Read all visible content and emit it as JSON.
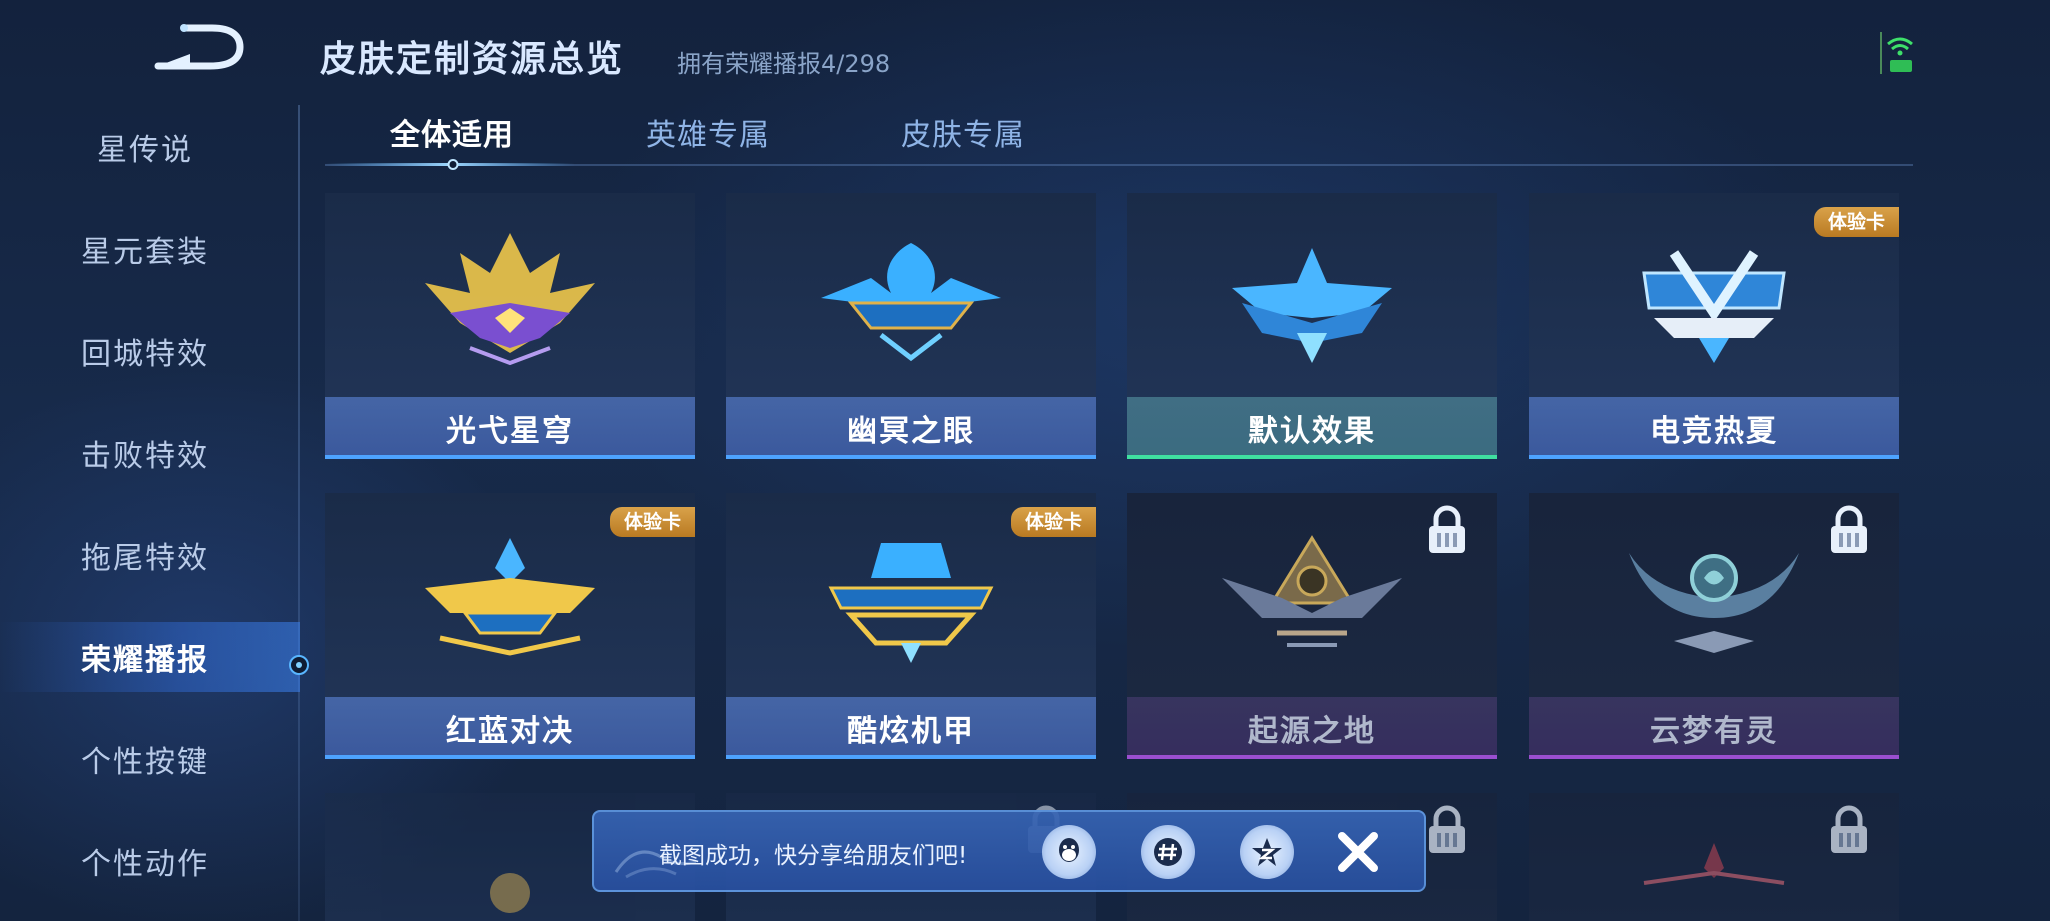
{
  "header": {
    "title": "皮肤定制资源总览",
    "subtitle": "拥有荣耀播报4/298"
  },
  "sidebar": {
    "items": [
      {
        "label": "星传说"
      },
      {
        "label": "星元套装"
      },
      {
        "label": "回城特效"
      },
      {
        "label": "击败特效"
      },
      {
        "label": "拖尾特效"
      },
      {
        "label": "荣耀播报",
        "active": true
      },
      {
        "label": "个性按键"
      },
      {
        "label": "个性动作"
      }
    ]
  },
  "tabs": [
    {
      "label": "全体适用",
      "active": true
    },
    {
      "label": "英雄专属"
    },
    {
      "label": "皮肤专属"
    }
  ],
  "cards": [
    {
      "label": "光弋星穹"
    },
    {
      "label": "幽冥之眼"
    },
    {
      "label": "默认效果"
    },
    {
      "label": "电竞热夏",
      "badge": "体验卡"
    },
    {
      "label": "红蓝对决",
      "badge": "体验卡"
    },
    {
      "label": "酷炫机甲",
      "badge": "体验卡"
    },
    {
      "label": "起源之地",
      "locked": true
    },
    {
      "label": "云梦有灵",
      "locked": true
    }
  ],
  "toast": {
    "message": "截图成功，快分享给朋友们吧!"
  },
  "colors": {
    "accent": "#4da3ff",
    "default_bar": "#3fe0a0",
    "locked_bar": "#9b4fd0",
    "badge": "#d9a24a"
  },
  "icons": [
    "back-arrow-icon",
    "wifi-signal-icon",
    "lock-icon",
    "qq-icon",
    "hashtag-icon",
    "star-share-icon",
    "close-icon"
  ]
}
